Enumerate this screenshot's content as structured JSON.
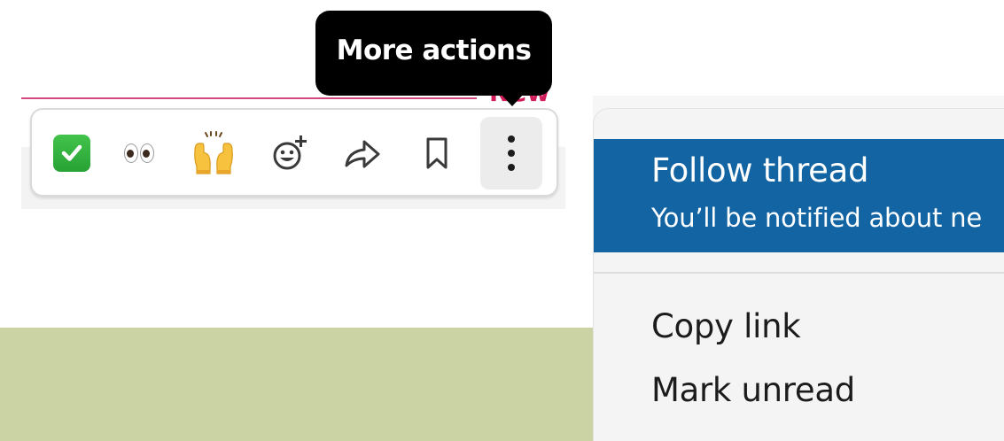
{
  "tooltip": {
    "text": "More actions"
  },
  "divider": {
    "label": "New",
    "color": "#d11d5c"
  },
  "toolbar": {
    "actions": [
      {
        "name": "white-check-mark-reaction",
        "icon": "check-mark-emoji"
      },
      {
        "name": "eyes-reaction",
        "icon": "eyes-emoji"
      },
      {
        "name": "raised-hands-reaction",
        "icon": "raised-hands-emoji"
      },
      {
        "name": "add-reaction",
        "icon": "smiley-plus-icon"
      },
      {
        "name": "forward",
        "icon": "share-arrow-icon"
      },
      {
        "name": "save-for-later",
        "icon": "bookmark-icon"
      },
      {
        "name": "more-actions",
        "icon": "vertical-ellipsis-icon",
        "active": true
      }
    ]
  },
  "menu": {
    "follow": {
      "title": "Follow thread",
      "subtitle": "You’ll be notified about ne"
    },
    "items": [
      {
        "label": "Copy link"
      },
      {
        "label": "Mark unread"
      }
    ],
    "highlight_color": "#1264a3"
  },
  "colors": {
    "green_block": "#cbd3a5",
    "tooltip_bg": "#000000"
  }
}
